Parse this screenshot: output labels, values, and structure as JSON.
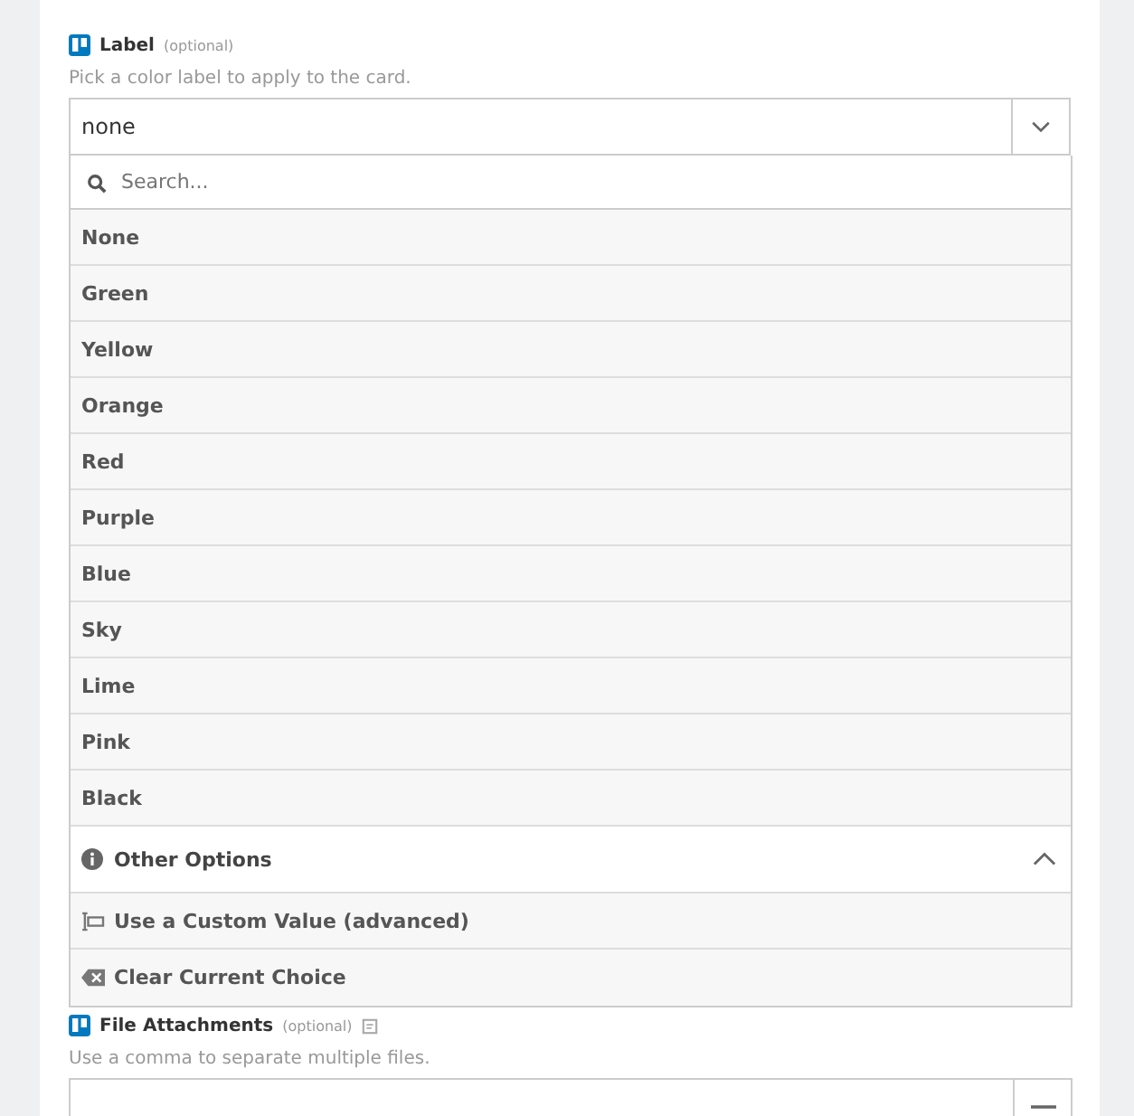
{
  "label_field": {
    "label": "Label",
    "optional": "(optional)",
    "description": "Pick a color label to apply to the card.",
    "value": "none"
  },
  "dropdown": {
    "search_placeholder": "Search...",
    "options": [
      {
        "label": "None"
      },
      {
        "label": "Green"
      },
      {
        "label": "Yellow"
      },
      {
        "label": "Orange"
      },
      {
        "label": "Red"
      },
      {
        "label": "Purple"
      },
      {
        "label": "Blue"
      },
      {
        "label": "Sky"
      },
      {
        "label": "Lime"
      },
      {
        "label": "Pink"
      },
      {
        "label": "Black"
      }
    ],
    "other_options": {
      "label": "Other Options",
      "expanded": true
    },
    "actions": [
      {
        "kind": "custom",
        "label": "Use a Custom Value (advanced)"
      },
      {
        "kind": "clear",
        "label": "Clear Current Choice"
      }
    ]
  },
  "attachments_field": {
    "label": "File Attachments",
    "optional": "(optional)",
    "description": "Use a comma to separate multiple files."
  }
}
